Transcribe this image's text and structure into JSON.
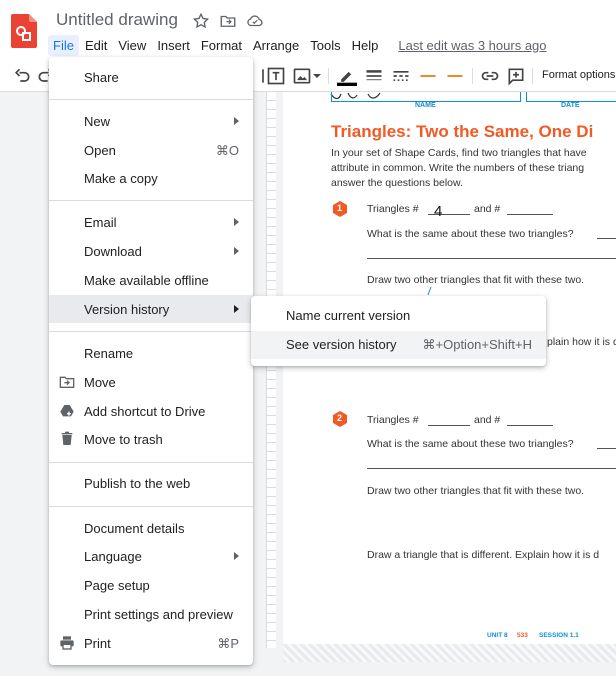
{
  "header": {
    "title": "Untitled drawing",
    "menus": [
      "File",
      "Edit",
      "View",
      "Insert",
      "Format",
      "Arrange",
      "Tools",
      "Help"
    ],
    "last_edit": "Last edit was 3 hours ago"
  },
  "toolbar": {
    "format_options": "Format options"
  },
  "file_menu": {
    "items": [
      {
        "label": "Share"
      },
      {
        "label": "New"
      },
      {
        "label": "Open",
        "shortcut": "⌘O"
      },
      {
        "label": "Make a copy"
      },
      {
        "label": "Email"
      },
      {
        "label": "Download"
      },
      {
        "label": "Make available offline"
      },
      {
        "label": "Version history"
      },
      {
        "label": "Rename"
      },
      {
        "label": "Move"
      },
      {
        "label": "Add shortcut to Drive"
      },
      {
        "label": "Move to trash"
      },
      {
        "label": "Publish to the web"
      },
      {
        "label": "Document details"
      },
      {
        "label": "Language"
      },
      {
        "label": "Page setup"
      },
      {
        "label": "Print settings and preview"
      },
      {
        "label": "Print",
        "shortcut": "⌘P"
      }
    ]
  },
  "version_submenu": {
    "items": [
      {
        "label": "Name current version"
      },
      {
        "label": "See version history",
        "shortcut": "⌘+Option+Shift+H"
      }
    ]
  },
  "worksheet": {
    "name_label": "NAME",
    "date_label": "DATE",
    "title": "Triangles: Two the Same, One Di",
    "intro": [
      "In your set of Shape Cards, find two triangles that have",
      "attribute in common. Write the numbers of these triang",
      "answer the questions below."
    ],
    "q1_number": "1",
    "q2_number": "2",
    "triangles_prefix": "Triangles #",
    "and_label": "and #",
    "handwritten_value": "4",
    "q_same": "What is the same about these two triangles?",
    "q_draw_two": "Draw two other triangles that fit with these two.",
    "q_explain_partial": "plain how it is d",
    "q_draw_diff": "Draw a triangle that is different. Explain how it is d",
    "footer_unit": "UNIT 8",
    "footer_page": "533",
    "footer_session": "SESSION 1.1"
  },
  "colors": {
    "accent": "#1a73e8",
    "title_orange": "#f15a24",
    "worksheet_blue": "#0e8ed6",
    "app_red": "#ea4335"
  }
}
